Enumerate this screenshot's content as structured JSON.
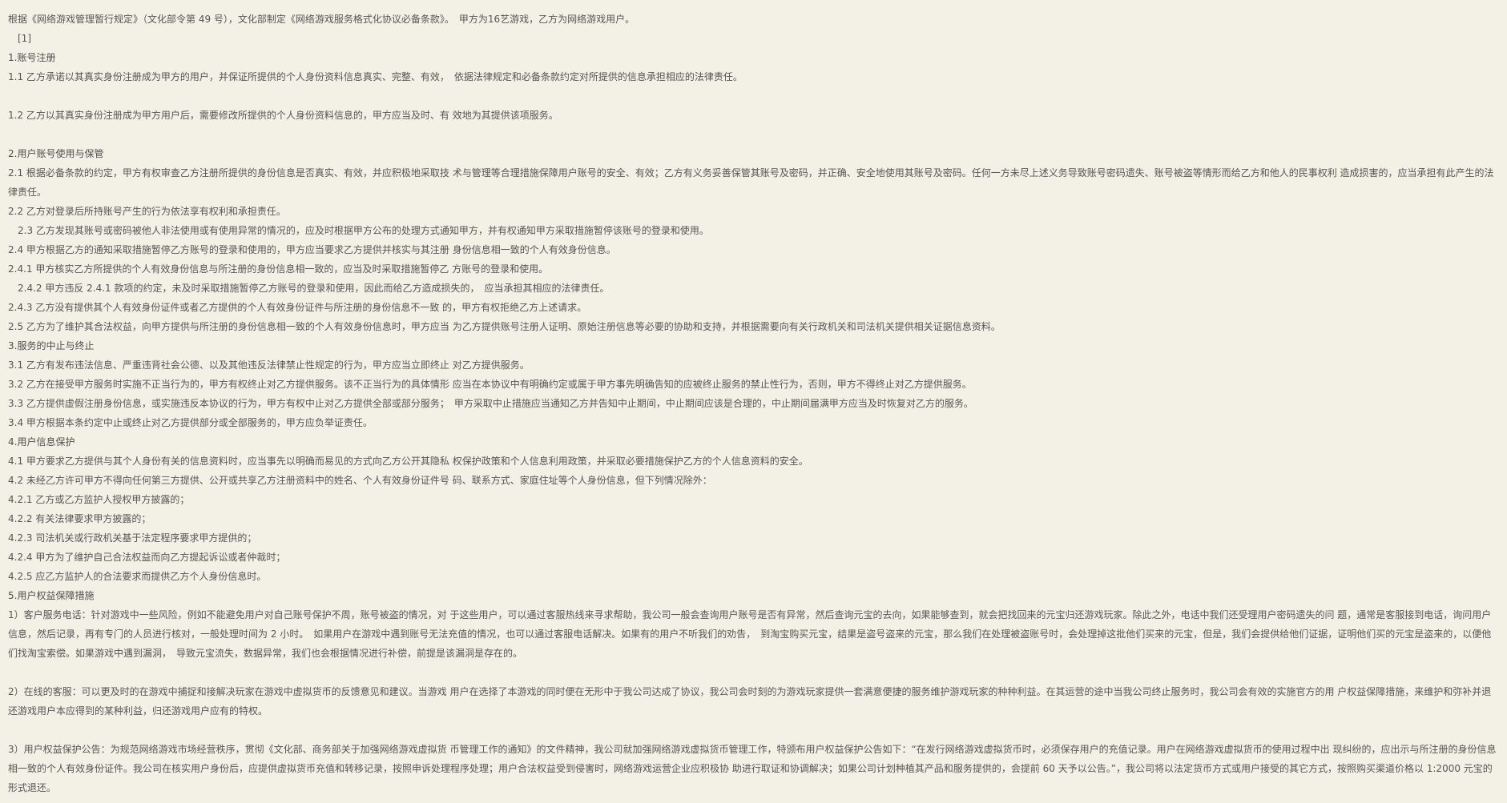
{
  "lines": [
    "根据《网络游戏管理暂行规定》（文化部令第 49 号），文化部制定《网络游戏服务格式化协议必备条款》。　甲方为16艺游戏，乙方为网络游戏用户。",
    "[1]",
    "1.账号注册",
    "1.1 乙方承诺以其真实身份注册成为甲方的用户，并保证所提供的个人身份资料信息真实、完整、有效，　依据法律规定和必备条款约定对所提供的信息承担相应的法律责任。",
    "1.2 乙方以其真实身份注册成为甲方用户后，需要修改所提供的个人身份资料信息的，甲方应当及时、有 效地为其提供该项服务。",
    "2.用户账号使用与保管",
    "2.1 根据必备条款的约定，甲方有权审查乙方注册所提供的身份信息是否真实、有效，并应积极地采取技 术与管理等合理措施保障用户账号的安全、有效；乙方有义务妥善保管其账号及密码，并正确、安全地使用其账号及密码。任何一方未尽上述义务导致账号密码遗失、账号被盗等情形而给乙方和他人的民事权利 造成损害的，应当承担有此产生的法律责任。",
    "2.2 乙方对登录后所持账号产生的行为依法享有权利和承担责任。",
    "2.3 乙方发现其账号或密码被他人非法使用或有使用异常的情况的，应及时根据甲方公布的处理方式通知甲方，并有权通知甲方采取措施暂停该账号的登录和使用。",
    "2.4 甲方根据乙方的通知采取措施暂停乙方账号的登录和使用的，甲方应当要求乙方提供并核实与其注册 身份信息相一致的个人有效身份信息。",
    "2.4.1 甲方核实乙方所提供的个人有效身份信息与所注册的身份信息相一致的，应当及时采取措施暂停乙 方账号的登录和使用。",
    "2.4.2 甲方违反 2.4.1 款项的约定，未及时采取措施暂停乙方账号的登录和使用，因此而给乙方造成损失的，　应当承担其相应的法律责任。",
    "2.4.3 乙方没有提供其个人有效身份证件或者乙方提供的个人有效身份证件与所注册的身份信息不一致 的，甲方有权拒绝乙方上述请求。",
    "2.5 乙方为了维护其合法权益，向甲方提供与所注册的身份信息相一致的个人有效身份信息时，甲方应当 为乙方提供账号注册人证明、原始注册信息等必要的协助和支持，并根据需要向有关行政机关和司法机关提供相关证据信息资料。",
    "3.服务的中止与终止",
    "3.1 乙方有发布违法信息、严重违背社会公德、以及其他违反法律禁止性规定的行为，甲方应当立即终止 对乙方提供服务。",
    "3.2 乙方在接受甲方服务时实施不正当行为的，甲方有权终止对乙方提供服务。该不正当行为的具体情形 应当在本协议中有明确约定或属于甲方事先明确告知的应被终止服务的禁止性行为，否则，甲方不得终止对乙方提供服务。",
    "3.3 乙方提供虚假注册身份信息，或实施违反本协议的行为，甲方有权中止对乙方提供全部或部分服务；　甲方采取中止措施应当通知乙方并告知中止期间，中止期间应该是合理的，中止期间届满甲方应当及时恢复对乙方的服务。",
    "3.4 甲方根据本条约定中止或终止对乙方提供部分或全部服务的，甲方应负举证责任。",
    "4.用户信息保护",
    "4.1 甲方要求乙方提供与其个人身份有关的信息资料时，应当事先以明确而易见的方式向乙方公开其隐私 权保护政策和个人信息利用政策，并采取必要措施保护乙方的个人信息资料的安全。",
    "4.2 未经乙方许可甲方不得向任何第三方提供、公开或共享乙方注册资料中的姓名、个人有效身份证件号 码、联系方式、家庭住址等个人身份信息，但下列情况除外：",
    "4.2.1 乙方或乙方监护人授权甲方披露的；",
    "4.2.2 有关法律要求甲方披露的；",
    "4.2.3 司法机关或行政机关基于法定程序要求甲方提供的；",
    "4.2.4 甲方为了维护自己合法权益而向乙方提起诉讼或者仲裁时；",
    "4.2.5 应乙方监护人的合法要求而提供乙方个人身份信息时。",
    "5.用户权益保障措施",
    "1）客户服务电话：针对游戏中一些风险，例如不能避免用户对自己账号保护不周，账号被盗的情况，对 于这些用户，可以通过客服热线来寻求帮助，我公司一般会查询用户账号是否有异常，然后查询元宝的去向，如果能够查到，就会把找回来的元宝归还游戏玩家。除此之外，电话中我们还受理用户密码遗失的问 题，通常是客服接到电话，询问用户信息，然后记录，再有专门的人员进行核对，一般处理时间为 2 小时。　如果用户在游戏中遇到账号无法充值的情况，也可以通过客服电话解决。如果有的用户不听我们的劝告，　到淘宝购买元宝，结果是盗号盗来的元宝，那么我们在处理被盗账号时，会处理掉这批他们买来的元宝，但是，我们会提供给他们证据，证明他们买的元宝是盗来的，以便他们找淘宝索偿。如果游戏中遇到漏洞，　导致元宝流失，数据异常，我们也会根据情况进行补偿，前提是该漏洞是存在的。",
    "2）在线的客服：可以更及时的在游戏中捕捉和接解决玩家在游戏中虚拟货币的反馈意见和建议。当游戏 用户在选择了本游戏的同时便在无形中于我公司达成了协议，我公司会时刻的为游戏玩家提供一套满意便捷的服务维护游戏玩家的种种利益。在其运营的途中当我公司终止服务时，我公司会有效的实施官方的用 户权益保障措施，来维护和弥补并退还游戏用户本应得到的某种利益，归还游戏用户应有的特权。",
    "3）用户权益保护公告：为规范网络游戏市场经营秩序，贯彻《文化部、商务部关于加强网络游戏虚拟货 币管理工作的通知》的文件精神，我公司就加强网络游戏虚拟货币管理工作，特颁布用户权益保护公告如下：“在发行网络游戏虚拟货币时，必须保存用户的充值记录。用户在网络游戏虚拟货币的使用过程中出 现纠纷的，应出示与所注册的身份信息相一致的个人有效身份证件。我公司在核实用户身份后，应提供虚拟货币充值和转移记录，按照申诉处理程序处理；用户合法权益受到侵害时，网络游戏运营企业应积极协 助进行取证和协调解决；如果公司计划种植其产品和服务提供的，会提前 60 天予以公告。”，我公司将以法定货币方式或用户接受的其它方式，按照购买渠道价格以 1:2000 元宝的形式退还。"
  ]
}
